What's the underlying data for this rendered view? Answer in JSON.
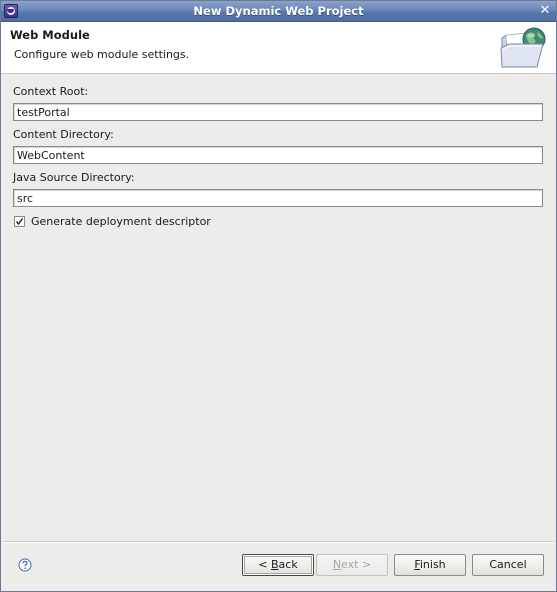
{
  "window": {
    "title": "New Dynamic Web Project",
    "close_glyph": "✕",
    "app_icon": "eclipse-icon"
  },
  "banner": {
    "title": "Web Module",
    "description": "Configure web module settings.",
    "image": "folder-globe-icon"
  },
  "form": {
    "context_root": {
      "label": "Context Root:",
      "value": "testPortal"
    },
    "content_directory": {
      "label": "Content Directory:",
      "value": "WebContent"
    },
    "java_source_directory": {
      "label": "Java Source Directory:",
      "value": "src"
    },
    "generate_descriptor": {
      "label": "Generate deployment descriptor",
      "checked": true
    }
  },
  "buttons": {
    "help_icon": "help-icon",
    "back": {
      "prefix": "< ",
      "mnemonic": "B",
      "rest": "ack",
      "enabled": true
    },
    "next": {
      "mnemonic": "N",
      "rest": "ext >",
      "enabled": false
    },
    "finish": {
      "mnemonic": "F",
      "rest": "inish",
      "enabled": true
    },
    "cancel": {
      "label": "Cancel",
      "enabled": true
    }
  },
  "colors": {
    "titlebar": "#5877ab",
    "dialog_bg": "#edeceb",
    "banner_bg": "#ffffff",
    "help_blue": "#3d6eb4"
  }
}
